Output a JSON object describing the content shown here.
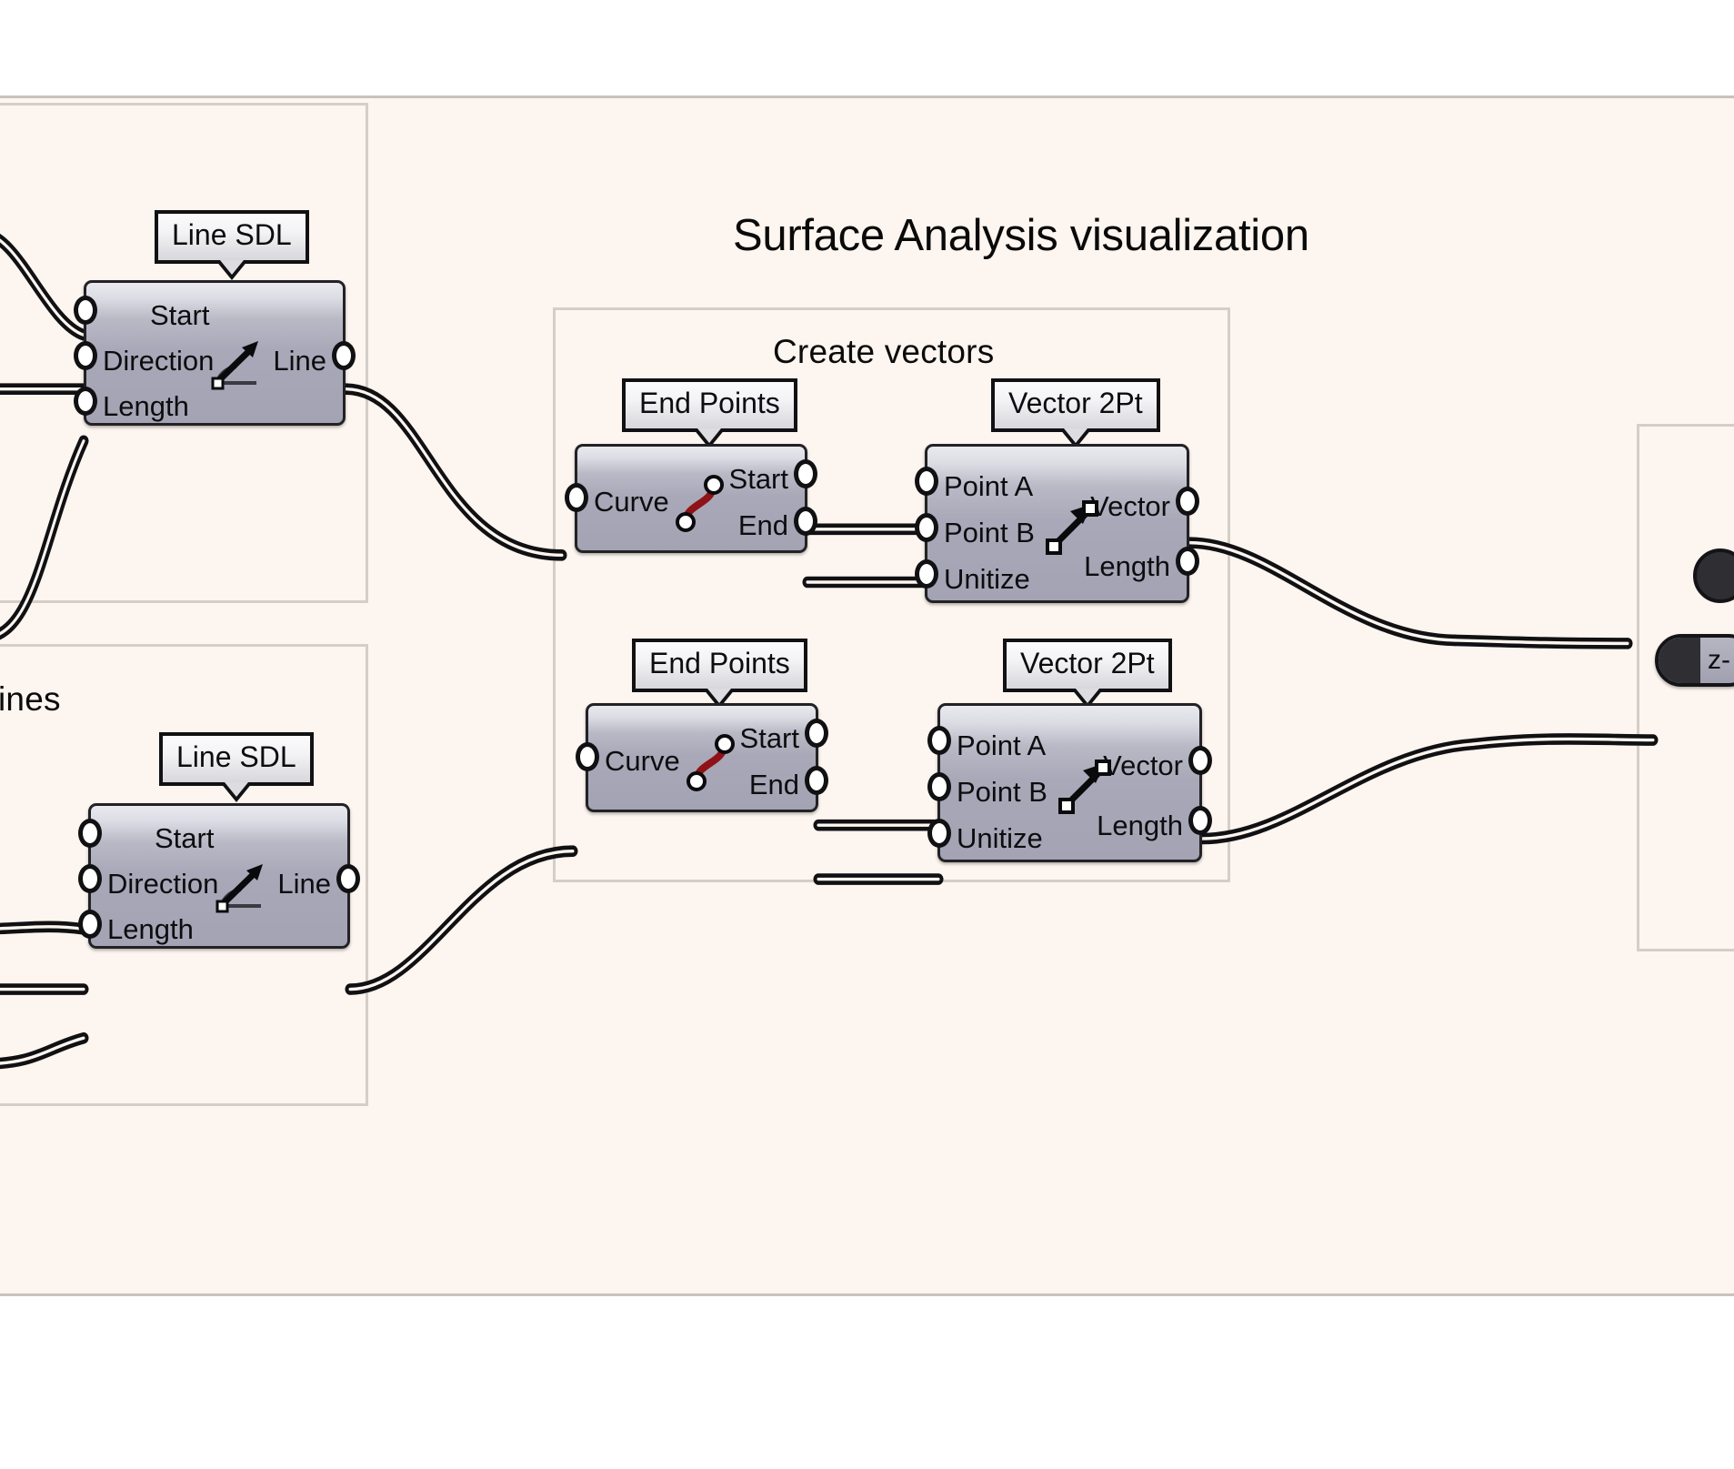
{
  "page": {
    "title": "Surface Analysis visualization",
    "canvas_bg": "#fdf5ef",
    "group_border": "#d5cec8",
    "node_accent": "#a3a3b3",
    "curve_icon_color": "#8f1216"
  },
  "groups": [
    {
      "id": "group-lines-top",
      "title": ""
    },
    {
      "id": "group-lines-bottom",
      "title": "ines"
    },
    {
      "id": "group-create-vectors",
      "title": "Create vectors"
    },
    {
      "id": "group-right",
      "title": ""
    }
  ],
  "nodes": [
    {
      "id": "line-sdl-top",
      "name": "Line SDL",
      "icon": "vector-angle-icon",
      "inputs": [
        "Start",
        "Direction",
        "Length"
      ],
      "outputs": [
        "Line"
      ]
    },
    {
      "id": "line-sdl-bottom",
      "name": "Line SDL",
      "icon": "vector-angle-icon",
      "inputs": [
        "Start",
        "Direction",
        "Length"
      ],
      "outputs": [
        "Line"
      ]
    },
    {
      "id": "end-points-top",
      "name": "End Points",
      "icon": "curve-endpoints-icon",
      "inputs": [
        "Curve"
      ],
      "outputs": [
        "Start",
        "End"
      ]
    },
    {
      "id": "end-points-bottom",
      "name": "End Points",
      "icon": "curve-endpoints-icon",
      "inputs": [
        "Curve"
      ],
      "outputs": [
        "Start",
        "End"
      ]
    },
    {
      "id": "vector-2pt-top",
      "name": "Vector 2Pt",
      "icon": "two-point-vector-icon",
      "inputs": [
        "Point A",
        "Point B",
        "Unitize"
      ],
      "outputs": [
        "Vector",
        "Length"
      ]
    },
    {
      "id": "vector-2pt-bottom",
      "name": "Vector 2Pt",
      "icon": "two-point-vector-icon",
      "inputs": [
        "Point A",
        "Point B",
        "Unitize"
      ],
      "outputs": [
        "Vector",
        "Length"
      ]
    }
  ],
  "badges": [
    {
      "id": "z-badge",
      "label": "z-"
    }
  ]
}
